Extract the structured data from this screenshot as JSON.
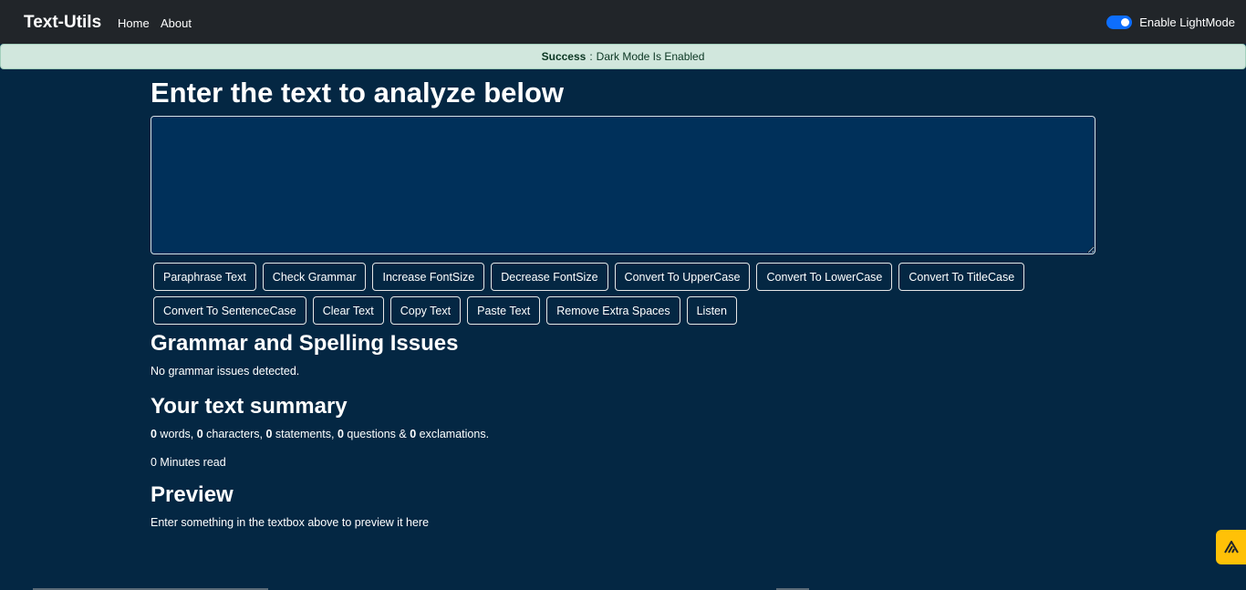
{
  "nav": {
    "brand": "Text-Utils",
    "home": "Home",
    "about": "About",
    "toggle_label": "Enable LightMode",
    "toggle_on": true
  },
  "alert": {
    "type": "Success",
    "separator": ":",
    "message": "Dark Mode Is Enabled"
  },
  "main": {
    "title": "Enter the text to analyze below",
    "textarea_value": ""
  },
  "buttons": {
    "paraphrase": "Paraphrase Text",
    "grammar": "Check Grammar",
    "increase_font": "Increase FontSize",
    "decrease_font": "Decrease FontSize",
    "upper": "Convert To UpperCase",
    "lower": "Convert To LowerCase",
    "title": "Convert To TitleCase",
    "sentence": "Convert To SentenceCase",
    "clear": "Clear Text",
    "copy": "Copy Text",
    "paste": "Paste Text",
    "remove_spaces": "Remove Extra Spaces",
    "listen": "Listen"
  },
  "grammar": {
    "heading": "Grammar and Spelling Issues",
    "message": "No grammar issues detected."
  },
  "summary": {
    "heading": "Your text summary",
    "words": "0",
    "words_label": " words, ",
    "characters": "0",
    "characters_label": " characters, ",
    "statements": "0",
    "statements_label": " statements, ",
    "questions": "0",
    "questions_label": " questions & ",
    "exclamations": "0",
    "exclamations_label": " exclamations.",
    "read_time": "0 Minutes read"
  },
  "preview": {
    "heading": "Preview",
    "placeholder": "Enter something in the textbox above to preview it here"
  },
  "colors": {
    "background": "#042743",
    "navbar": "#212529",
    "alert_bg": "#d1e7dd",
    "textarea_bg": "#00305a",
    "toggle": "#0d6efd",
    "floating_button": "#ffc107"
  }
}
